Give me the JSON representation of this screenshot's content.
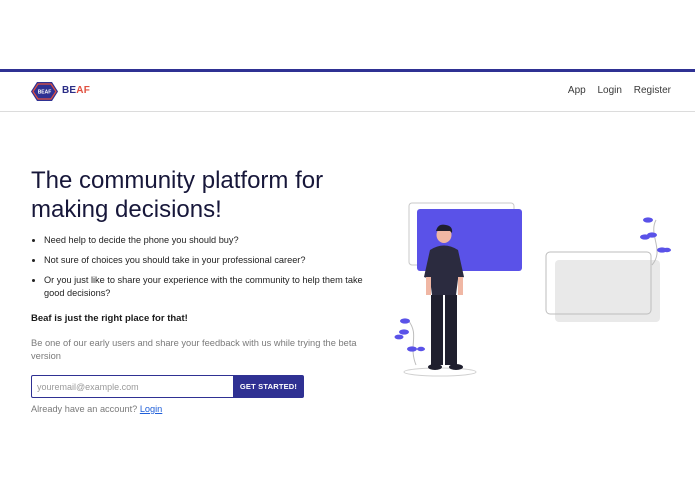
{
  "brand": {
    "badge_text": "BEAF",
    "name_part1": "BE",
    "name_part2": "AF",
    "colors": {
      "primary": "#2f3193",
      "accent": "#e0503f",
      "illustration": "#5a52e8"
    }
  },
  "nav": {
    "links": [
      "App",
      "Login",
      "Register"
    ]
  },
  "hero": {
    "title": "The community platform for making decisions!",
    "bullets": [
      "Need help to decide the phone you should buy?",
      "Not sure of choices you should take in your professional career?",
      "Or you just like to share your experience with the community to help them take good decisions?"
    ],
    "tagline": "Beaf is just the right place for that!",
    "subtext": "Be one of our early users and share your feedback with us while trying the beta version"
  },
  "signup": {
    "email_placeholder": "youremail@example.com",
    "email_value": "",
    "cta_label": "GET STARTED!",
    "have_account_text": "Already have an account?",
    "login_link": "Login"
  },
  "illustration": {
    "icon": "person-with-screens-illustration"
  }
}
